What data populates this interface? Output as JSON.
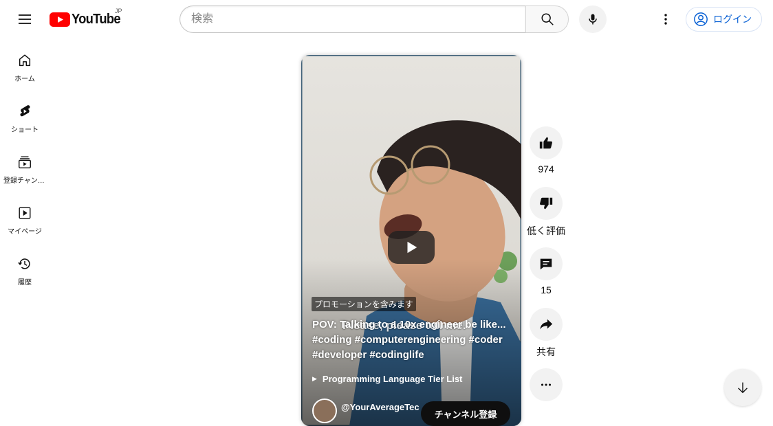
{
  "header": {
    "logo_text": "YouTube",
    "logo_country": "JP",
    "search_placeholder": "検索",
    "login_label": "ログイン"
  },
  "sidebar": {
    "items": [
      {
        "label": "ホーム",
        "icon": "home-icon"
      },
      {
        "label": "ショート",
        "icon": "shorts-icon"
      },
      {
        "label": "登録チャンネル",
        "icon": "subscriptions-icon"
      },
      {
        "label": "マイページ",
        "icon": "you-icon"
      },
      {
        "label": "履歴",
        "icon": "history-icon"
      }
    ]
  },
  "video": {
    "promotion_badge": "プロモーションを含みます",
    "caption": "POV: Talking to a 10x engineer be like... #coding #computerengineering #coder #developer #codinglife",
    "subtitle_overlay": "Please, please tell me.",
    "playlist": "Programming Language Tier List",
    "channel_name": "@YourAverageTec",
    "subscribe_label": "チャンネル登録"
  },
  "actions": {
    "like_count": "974",
    "dislike_label": "低く評価",
    "comment_count": "15",
    "share_label": "共有"
  },
  "colors": {
    "brand_red": "#ff0000",
    "link_blue": "#065fd4",
    "text": "#0f0f0f"
  }
}
